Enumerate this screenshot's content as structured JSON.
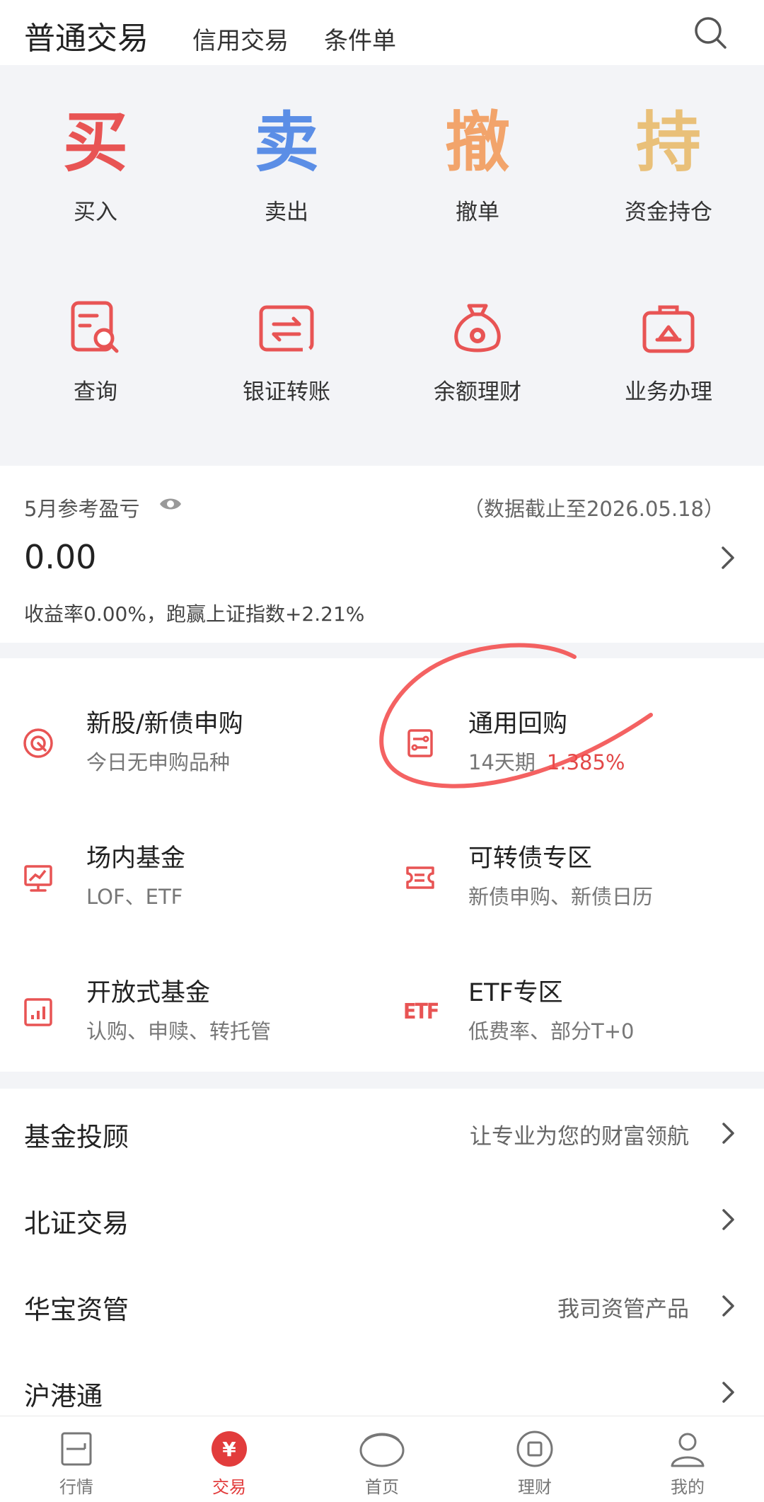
{
  "header": {
    "tab_main": "普通交易",
    "tab_credit": "信用交易",
    "tab_condition": "条件单",
    "search_icon": "search-icon"
  },
  "quick_actions": [
    {
      "glyph": "买",
      "label": "买入",
      "color": "#e85454"
    },
    {
      "glyph": "卖",
      "label": "卖出",
      "color": "#5b8ee6"
    },
    {
      "glyph": "撤",
      "label": "撤单",
      "color": "#f2a46b"
    },
    {
      "glyph": "持",
      "label": "资金持仓",
      "color": "#e9c079"
    },
    {
      "icon": "query-icon",
      "label": "查询"
    },
    {
      "icon": "transfer-icon",
      "label": "银证转账"
    },
    {
      "icon": "money-bag-icon",
      "label": "余额理财"
    },
    {
      "icon": "briefcase-icon",
      "label": "业务办理"
    }
  ],
  "pl": {
    "title": "5月参考盈亏",
    "date": "（数据截止至2026.05.18）",
    "value": "0.00",
    "footer": "收益率0.00%，跑赢上证指数+2.21%"
  },
  "products": [
    {
      "title": "新股/新债申购",
      "sub": "今日无申购品种",
      "rate": ""
    },
    {
      "title": "通用回购",
      "sub": "14天期",
      "rate": "1.385%"
    },
    {
      "title": "场内基金",
      "sub": "LOF、ETF",
      "rate": ""
    },
    {
      "title": "可转债专区",
      "sub": "新债申购、新债日历",
      "rate": ""
    },
    {
      "title": "开放式基金",
      "sub": "认购、申赎、转托管",
      "rate": ""
    },
    {
      "title": "ETF专区",
      "sub": "低费率、部分T+0",
      "rate": "",
      "icon_text": "ETF"
    }
  ],
  "rows": [
    {
      "title": "基金投顾",
      "desc": "让专业为您的财富领航"
    },
    {
      "title": "北证交易",
      "desc": ""
    },
    {
      "title": "华宝资管",
      "desc": "我司资管产品"
    },
    {
      "title": "沪港通",
      "desc": ""
    }
  ],
  "nav": [
    {
      "label": "行情",
      "icon": "market-icon"
    },
    {
      "label": "交易",
      "icon": "yuan-icon",
      "active": true
    },
    {
      "label": "首页",
      "icon": "home-icon"
    },
    {
      "label": "理财",
      "icon": "wealth-icon"
    },
    {
      "label": "我的",
      "icon": "user-icon"
    }
  ],
  "colors": {
    "accent_red": "#e23c3c",
    "icon_red": "#e85454",
    "grey_bg": "#f3f4f7"
  }
}
